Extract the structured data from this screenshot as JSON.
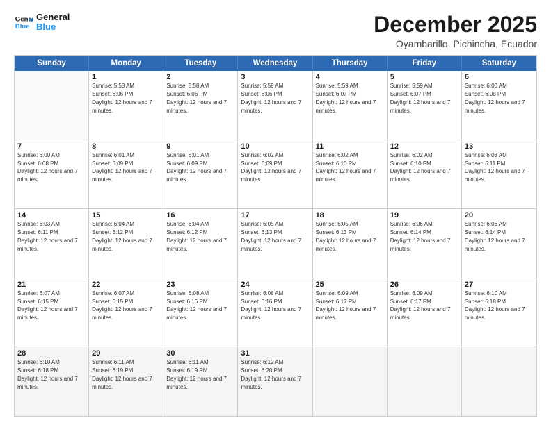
{
  "logo": {
    "line1": "General",
    "line2": "Blue"
  },
  "title": "December 2025",
  "location": "Oyambarillo, Pichincha, Ecuador",
  "header_days": [
    "Sunday",
    "Monday",
    "Tuesday",
    "Wednesday",
    "Thursday",
    "Friday",
    "Saturday"
  ],
  "weeks": [
    [
      {
        "day": "",
        "empty": true
      },
      {
        "day": "1",
        "rise": "5:58 AM",
        "set": "6:06 PM",
        "daylight": "12 hours and 7 minutes."
      },
      {
        "day": "2",
        "rise": "5:58 AM",
        "set": "6:06 PM",
        "daylight": "12 hours and 7 minutes."
      },
      {
        "day": "3",
        "rise": "5:59 AM",
        "set": "6:06 PM",
        "daylight": "12 hours and 7 minutes."
      },
      {
        "day": "4",
        "rise": "5:59 AM",
        "set": "6:07 PM",
        "daylight": "12 hours and 7 minutes."
      },
      {
        "day": "5",
        "rise": "5:59 AM",
        "set": "6:07 PM",
        "daylight": "12 hours and 7 minutes."
      },
      {
        "day": "6",
        "rise": "6:00 AM",
        "set": "6:08 PM",
        "daylight": "12 hours and 7 minutes."
      }
    ],
    [
      {
        "day": "7",
        "rise": "6:00 AM",
        "set": "6:08 PM",
        "daylight": "12 hours and 7 minutes."
      },
      {
        "day": "8",
        "rise": "6:01 AM",
        "set": "6:09 PM",
        "daylight": "12 hours and 7 minutes."
      },
      {
        "day": "9",
        "rise": "6:01 AM",
        "set": "6:09 PM",
        "daylight": "12 hours and 7 minutes."
      },
      {
        "day": "10",
        "rise": "6:02 AM",
        "set": "6:09 PM",
        "daylight": "12 hours and 7 minutes."
      },
      {
        "day": "11",
        "rise": "6:02 AM",
        "set": "6:10 PM",
        "daylight": "12 hours and 7 minutes."
      },
      {
        "day": "12",
        "rise": "6:02 AM",
        "set": "6:10 PM",
        "daylight": "12 hours and 7 minutes."
      },
      {
        "day": "13",
        "rise": "6:03 AM",
        "set": "6:11 PM",
        "daylight": "12 hours and 7 minutes."
      }
    ],
    [
      {
        "day": "14",
        "rise": "6:03 AM",
        "set": "6:11 PM",
        "daylight": "12 hours and 7 minutes."
      },
      {
        "day": "15",
        "rise": "6:04 AM",
        "set": "6:12 PM",
        "daylight": "12 hours and 7 minutes."
      },
      {
        "day": "16",
        "rise": "6:04 AM",
        "set": "6:12 PM",
        "daylight": "12 hours and 7 minutes."
      },
      {
        "day": "17",
        "rise": "6:05 AM",
        "set": "6:13 PM",
        "daylight": "12 hours and 7 minutes."
      },
      {
        "day": "18",
        "rise": "6:05 AM",
        "set": "6:13 PM",
        "daylight": "12 hours and 7 minutes."
      },
      {
        "day": "19",
        "rise": "6:06 AM",
        "set": "6:14 PM",
        "daylight": "12 hours and 7 minutes."
      },
      {
        "day": "20",
        "rise": "6:06 AM",
        "set": "6:14 PM",
        "daylight": "12 hours and 7 minutes."
      }
    ],
    [
      {
        "day": "21",
        "rise": "6:07 AM",
        "set": "6:15 PM",
        "daylight": "12 hours and 7 minutes."
      },
      {
        "day": "22",
        "rise": "6:07 AM",
        "set": "6:15 PM",
        "daylight": "12 hours and 7 minutes."
      },
      {
        "day": "23",
        "rise": "6:08 AM",
        "set": "6:16 PM",
        "daylight": "12 hours and 7 minutes."
      },
      {
        "day": "24",
        "rise": "6:08 AM",
        "set": "6:16 PM",
        "daylight": "12 hours and 7 minutes."
      },
      {
        "day": "25",
        "rise": "6:09 AM",
        "set": "6:17 PM",
        "daylight": "12 hours and 7 minutes."
      },
      {
        "day": "26",
        "rise": "6:09 AM",
        "set": "6:17 PM",
        "daylight": "12 hours and 7 minutes."
      },
      {
        "day": "27",
        "rise": "6:10 AM",
        "set": "6:18 PM",
        "daylight": "12 hours and 7 minutes."
      }
    ],
    [
      {
        "day": "28",
        "rise": "6:10 AM",
        "set": "6:18 PM",
        "daylight": "12 hours and 7 minutes."
      },
      {
        "day": "29",
        "rise": "6:11 AM",
        "set": "6:19 PM",
        "daylight": "12 hours and 7 minutes."
      },
      {
        "day": "30",
        "rise": "6:11 AM",
        "set": "6:19 PM",
        "daylight": "12 hours and 7 minutes."
      },
      {
        "day": "31",
        "rise": "6:12 AM",
        "set": "6:20 PM",
        "daylight": "12 hours and 7 minutes."
      },
      {
        "day": "",
        "empty": true
      },
      {
        "day": "",
        "empty": true
      },
      {
        "day": "",
        "empty": true
      }
    ]
  ]
}
